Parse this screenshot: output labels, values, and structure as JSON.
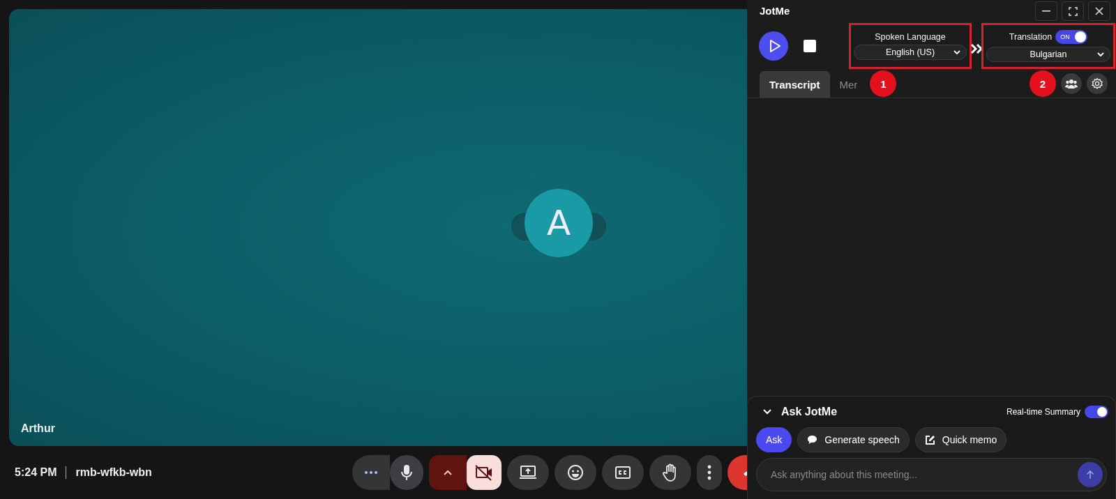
{
  "meeting": {
    "participant": {
      "name": "Arthur",
      "initial": "A"
    },
    "time": "5:24 PM",
    "code": "rmb-wfkb-wbn",
    "controls": [
      {
        "kind": "more"
      },
      {
        "kind": "mic",
        "active": true
      },
      {
        "kind": "chevron"
      },
      {
        "kind": "camera",
        "active": false
      },
      {
        "kind": "present"
      },
      {
        "kind": "emoji"
      },
      {
        "kind": "captions"
      },
      {
        "kind": "hand"
      },
      {
        "kind": "menu"
      },
      {
        "kind": "end"
      }
    ]
  },
  "panel": {
    "title": "JotMe",
    "spoken_language": {
      "label": "Spoken Language",
      "value": "English (US)",
      "highlighted": true
    },
    "translation": {
      "label": "Translation",
      "switch_text": "ON",
      "on": true,
      "value": "Bulgarian",
      "highlighted": true
    },
    "tabs": [
      {
        "label": "Transcript",
        "selected": true
      },
      {
        "label": "Mer",
        "selected": false
      }
    ],
    "callouts": [
      {
        "number": "1"
      },
      {
        "number": "2"
      }
    ],
    "ask": {
      "title": "Ask JotMe",
      "expanded": true,
      "realtime_summary": {
        "label": "Real-time Summary",
        "on": true
      },
      "actions": [
        {
          "label": "Ask",
          "kind": "ask",
          "selected": true
        },
        {
          "label": "Generate speech",
          "kind": "speech",
          "selected": false
        },
        {
          "label": "Quick memo",
          "kind": "memo",
          "selected": false
        }
      ],
      "placeholder": "Ask anything about this meeting..."
    }
  }
}
